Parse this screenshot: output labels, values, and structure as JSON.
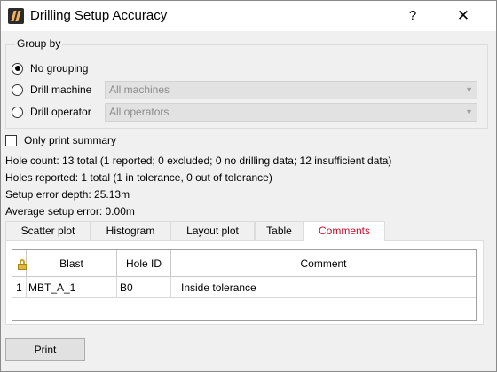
{
  "window": {
    "title": "Drilling Setup Accuracy",
    "help": "?",
    "close": "✕"
  },
  "group_by": {
    "title": "Group by",
    "options": [
      {
        "label": "No grouping",
        "checked": true
      },
      {
        "label": "Drill machine",
        "checked": false,
        "combo_value": "All machines"
      },
      {
        "label": "Drill operator",
        "checked": false,
        "combo_value": "All operators"
      }
    ]
  },
  "summary_checkbox": {
    "label": "Only print summary",
    "checked": false
  },
  "stats": {
    "hole_count": "Hole count: 13 total (1 reported; 0 excluded; 0 no drilling data; 12 insufficient data)",
    "holes_reported": "Holes reported: 1 total (1 in tolerance, 0 out of tolerance)",
    "setup_error_depth": "Setup error depth: 25.13m",
    "average_setup_error": "Average setup error: 0.00m"
  },
  "tabs": [
    {
      "label": "Scatter plot",
      "active": false
    },
    {
      "label": "Histogram",
      "active": false
    },
    {
      "label": "Layout plot",
      "active": false
    },
    {
      "label": "Table",
      "active": false
    },
    {
      "label": "Comments",
      "active": true
    }
  ],
  "table": {
    "columns": [
      "Blast",
      "Hole ID",
      "Comment"
    ],
    "rows": [
      {
        "index": "1",
        "blast": "MBT_A_1",
        "hole_id": "B0",
        "comment": "Inside tolerance"
      }
    ]
  },
  "print_button": {
    "label": "Print"
  },
  "colors": {
    "active_tab_text": "#c8102e",
    "background": "#f0f0f0"
  }
}
